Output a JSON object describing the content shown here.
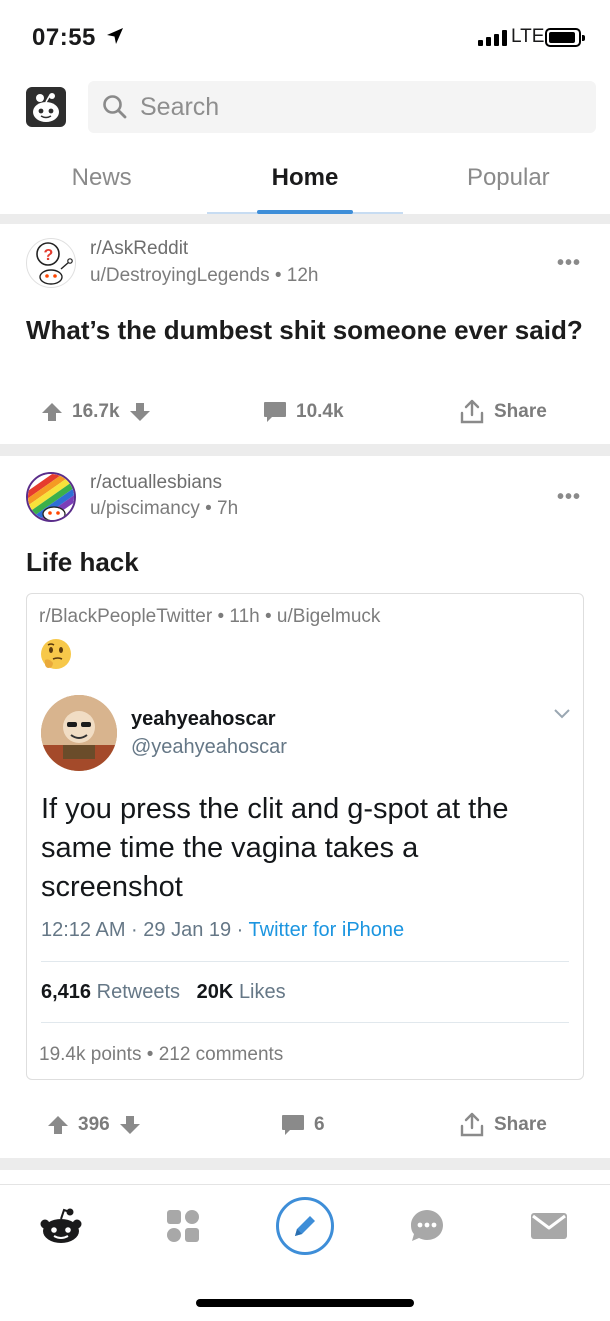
{
  "status_bar": {
    "time": "07:55",
    "network": "LTE"
  },
  "search": {
    "placeholder": "Search"
  },
  "tabs": [
    {
      "label": "News"
    },
    {
      "label": "Home"
    },
    {
      "label": "Popular"
    }
  ],
  "posts": [
    {
      "subreddit": "r/AskReddit",
      "author": "u/DestroyingLegends",
      "age": "12h",
      "title": "What’s the dumbest shit someone ever said?",
      "votes": "16.7k",
      "comments": "10.4k",
      "share_label": "Share"
    },
    {
      "subreddit": "r/actuallesbians",
      "author": "u/piscimancy",
      "age": "7h",
      "title": "Life hack",
      "votes": "396",
      "comments": "6",
      "share_label": "Share",
      "crosspost": {
        "subreddit": "r/BlackPeopleTwitter",
        "age": "11h",
        "author": "u/Bigelmuck",
        "emoji": "🤔",
        "tweet": {
          "name": "yeahyeahoscar",
          "handle": "@yeahyeahoscar",
          "text": "If you press the clit and g-spot at the same time the vagina takes a screenshot",
          "time": "12:12 AM · 29 Jan 19 · ",
          "source": "Twitter for iPhone",
          "retweets_count": "6,416",
          "retweets_label": "Retweets",
          "likes_count": "20K",
          "likes_label": "Likes"
        },
        "points": "19.4k points",
        "comments": "212 comments"
      }
    }
  ],
  "colors": {
    "accent": "#3e8ed8",
    "twitter_link": "#1b95e0"
  },
  "bottom_nav": [
    "reddit-home-icon",
    "communities-icon",
    "create-post-icon",
    "chat-icon",
    "inbox-icon"
  ]
}
